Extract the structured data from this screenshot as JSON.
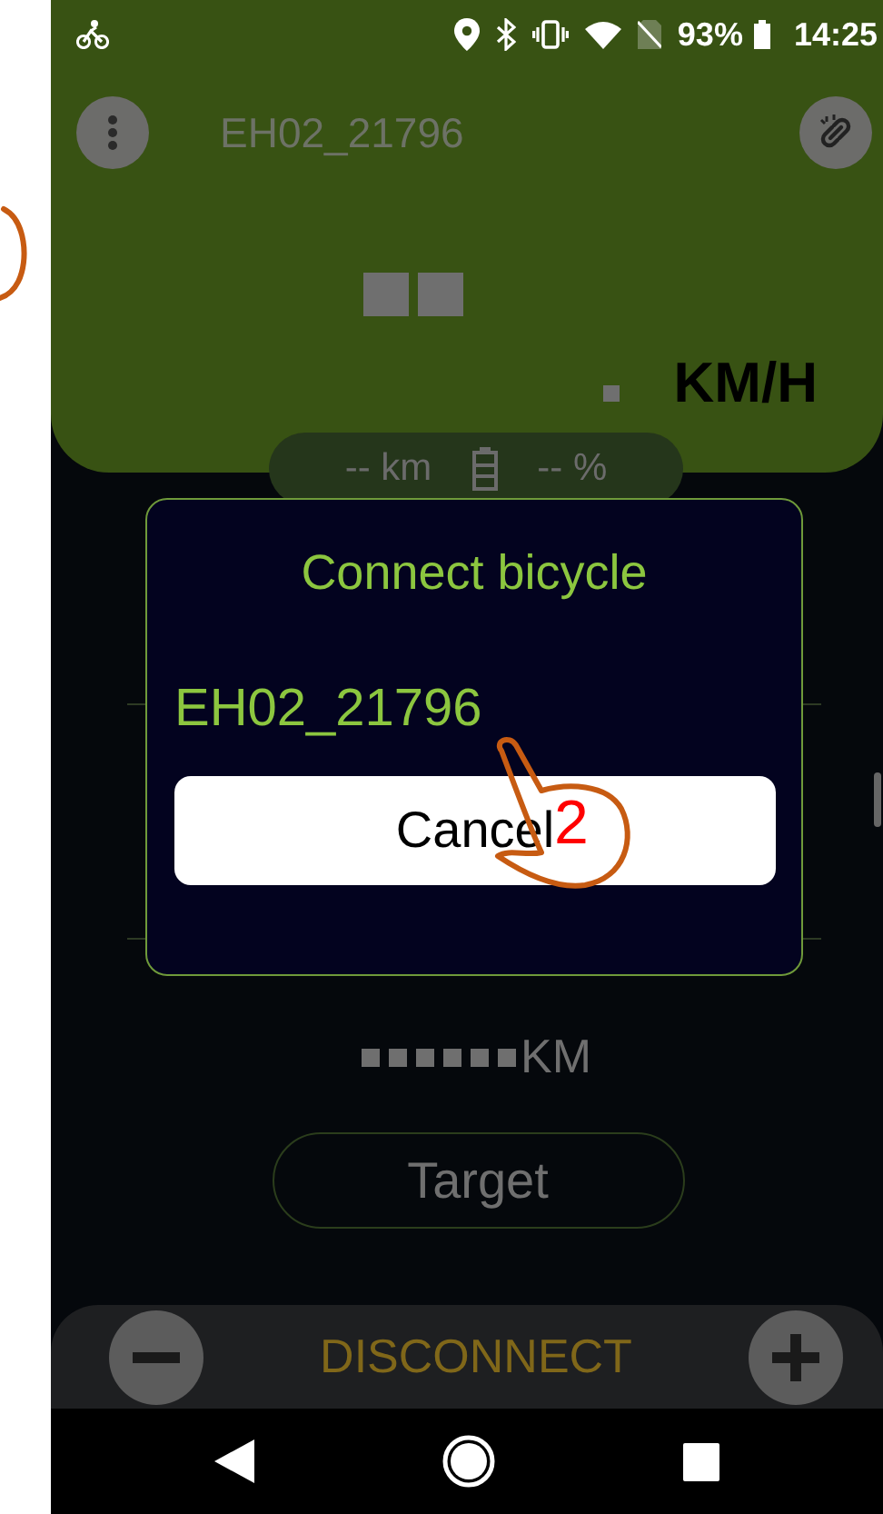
{
  "status_bar": {
    "battery": "93%",
    "time": "14:25"
  },
  "header": {
    "device_name": "EH02_21796",
    "speed_unit": "KM/H"
  },
  "range_pill": {
    "range": "-- km",
    "charge": "-- %"
  },
  "odometer": {
    "unit": "KM"
  },
  "target_button": {
    "label": "Target"
  },
  "bottom_bar": {
    "action": "DISCONNECT"
  },
  "dialog": {
    "title": "Connect bicycle",
    "devices": [
      {
        "name": "EH02_21796"
      }
    ],
    "cancel": "Cancel"
  },
  "annotation": {
    "step": "2"
  }
}
